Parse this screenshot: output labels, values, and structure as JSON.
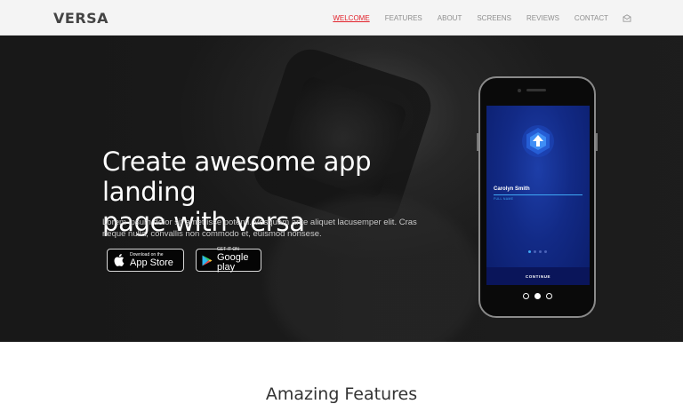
{
  "brand": {
    "logo": "VERSA"
  },
  "nav": {
    "items": [
      {
        "label": "WELCOME",
        "active": true
      },
      {
        "label": "FEATURES",
        "active": false
      },
      {
        "label": "ABOUT",
        "active": false
      },
      {
        "label": "SCREENS",
        "active": false
      },
      {
        "label": "REVIEWS",
        "active": false
      },
      {
        "label": "CONTACT",
        "active": false
      }
    ],
    "icon": "envelope-icon"
  },
  "hero": {
    "title_line1": "Create awesome app landing",
    "title_line2": "page with versa",
    "description": "Lorem ipsum dolor sit amet isse potenti. Vesquam ante aliquet lacusemper elit. Cras neque nulla, convallis non commodo et, euismod nonsese.",
    "app_store": {
      "small": "Download on the",
      "big": "App Store",
      "icon": "apple-icon"
    },
    "google_play": {
      "small": "GET IT ON",
      "big": "Google play",
      "icon": "play-icon"
    }
  },
  "phone": {
    "user_name": "Carolyn Smith",
    "field_label": "FULL NAME",
    "continue_label": "CONTINUE",
    "onboarding_dots_active": 1,
    "carousel_active": 2
  },
  "features": {
    "title": "Amazing Features"
  },
  "colors": {
    "accent": "#e2222b",
    "app_blue": "#122a86",
    "app_highlight": "#3fa9f5"
  }
}
